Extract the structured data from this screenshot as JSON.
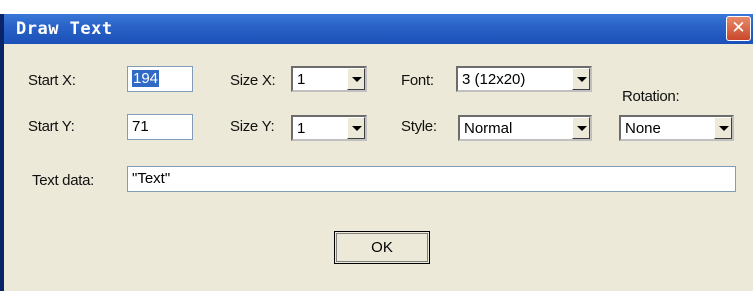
{
  "dialog": {
    "title": "Draw Text",
    "close_glyph": "✕",
    "labels": {
      "start_x": "Start X:",
      "start_y": "Start Y:",
      "size_x": "Size X:",
      "size_y": "Size Y:",
      "font": "Font:",
      "style": "Style:",
      "rotation": "Rotation:",
      "text_data": "Text data:"
    },
    "fields": {
      "start_x": "194",
      "start_y": "71",
      "text_data": "\"Text\""
    },
    "selects": {
      "size_x": "1",
      "size_y": "1",
      "font": "3 (12x20)",
      "style": "Normal",
      "rotation": "None"
    },
    "ok_label": "OK"
  },
  "colors": {
    "titlebar": "#2a63c8",
    "dialog_bg": "#ece9d8",
    "selection": "#316ac5",
    "close_button": "#c9472a"
  },
  "icons": {
    "close": "close-icon",
    "dropdown": "chevron-down-icon"
  }
}
